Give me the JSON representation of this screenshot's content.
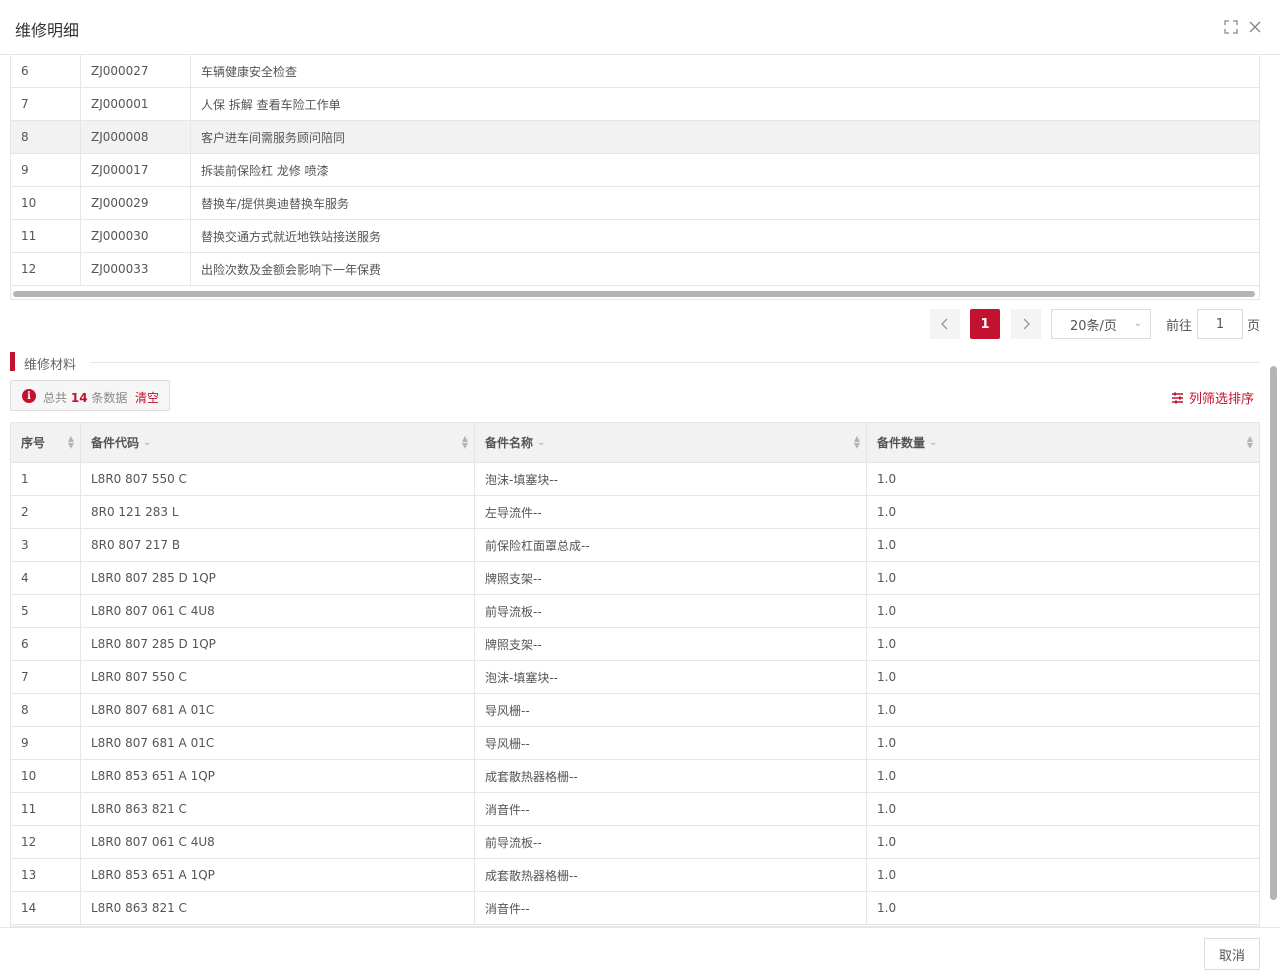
{
  "dialog": {
    "title": "维修明细"
  },
  "items_table": {
    "rows": [
      {
        "no": "6",
        "code": "ZJ000027",
        "desc": "车辆健康安全检查"
      },
      {
        "no": "7",
        "code": "ZJ000001",
        "desc": "人保 拆解 查看车险工作单"
      },
      {
        "no": "8",
        "code": "ZJ000008",
        "desc": "客户进车间需服务顾问陪同"
      },
      {
        "no": "9",
        "code": "ZJ000017",
        "desc": "拆装前保险杠 龙修 喷漆"
      },
      {
        "no": "10",
        "code": "ZJ000029",
        "desc": "替换车/提供奥迪替换车服务"
      },
      {
        "no": "11",
        "code": "ZJ000030",
        "desc": "替换交通方式就近地铁站接送服务"
      },
      {
        "no": "12",
        "code": "ZJ000033",
        "desc": "出险次数及金额会影响下一年保费"
      }
    ],
    "highlighted_row": "8"
  },
  "pagination": {
    "current_page": "1",
    "page_size": "20条/页",
    "goto_label": "前往",
    "goto_value": "1",
    "page_suffix": "页"
  },
  "materials": {
    "section_title": "维修材料",
    "summary_prefix": "总共",
    "summary_count": "14",
    "summary_suffix": "条数据",
    "clear_label": "清空",
    "column_filter_label": "列筛选排序",
    "columns": [
      "序号",
      "备件代码",
      "备件名称",
      "备件数量"
    ],
    "rows": [
      {
        "no": "1",
        "code": "L8R0 807 550 C",
        "name": "泡沫-填塞块--",
        "qty": "1.0"
      },
      {
        "no": "2",
        "code": "8R0 121 283 L",
        "name": "左导流件--",
        "qty": "1.0"
      },
      {
        "no": "3",
        "code": "8R0 807 217 B",
        "name": "前保险杠面罩总成--",
        "qty": "1.0"
      },
      {
        "no": "4",
        "code": "L8R0 807 285 D 1QP",
        "name": "牌照支架--",
        "qty": "1.0"
      },
      {
        "no": "5",
        "code": "L8R0 807 061 C 4U8",
        "name": "前导流板--",
        "qty": "1.0"
      },
      {
        "no": "6",
        "code": "L8R0 807 285 D 1QP",
        "name": "牌照支架--",
        "qty": "1.0"
      },
      {
        "no": "7",
        "code": "L8R0 807 550 C",
        "name": "泡沫-填塞块--",
        "qty": "1.0"
      },
      {
        "no": "8",
        "code": "L8R0 807 681 A 01C",
        "name": "导风栅--",
        "qty": "1.0"
      },
      {
        "no": "9",
        "code": "L8R0 807 681 A 01C",
        "name": "导风栅--",
        "qty": "1.0"
      },
      {
        "no": "10",
        "code": "L8R0 853 651 A 1QP",
        "name": "成套散热器格栅--",
        "qty": "1.0"
      },
      {
        "no": "11",
        "code": "L8R0 863 821 C",
        "name": "消音件--",
        "qty": "1.0"
      },
      {
        "no": "12",
        "code": "L8R0 807 061 C 4U8",
        "name": "前导流板--",
        "qty": "1.0"
      },
      {
        "no": "13",
        "code": "L8R0 853 651 A 1QP",
        "name": "成套散热器格栅--",
        "qty": "1.0"
      },
      {
        "no": "14",
        "code": "L8R0 863 821 C",
        "name": "消音件--",
        "qty": "1.0"
      }
    ]
  },
  "footer": {
    "cancel_label": "取消"
  },
  "colors": {
    "accent": "#c2122f",
    "border": "#e6e6e6",
    "header_bg": "#f2f2f2"
  },
  "icons": {
    "maximize": "maximize-icon",
    "close": "close-icon",
    "info": "info-icon",
    "filter": "filter-icon"
  }
}
